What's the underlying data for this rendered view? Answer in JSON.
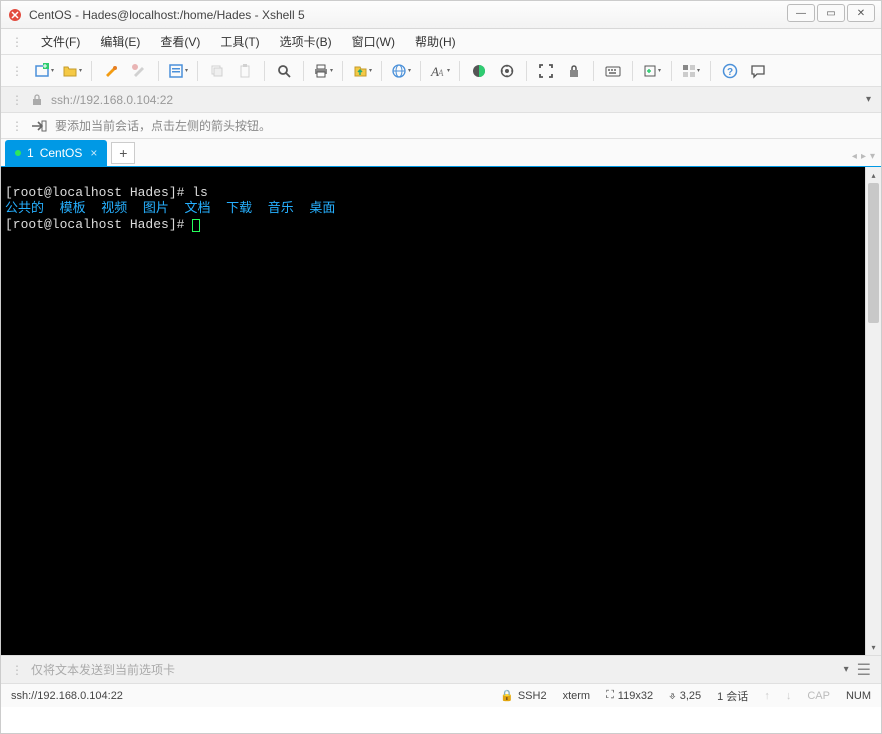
{
  "window": {
    "title": "CentOS - Hades@localhost:/home/Hades - Xshell 5"
  },
  "menu": {
    "file": "文件(F)",
    "edit": "编辑(E)",
    "view": "查看(V)",
    "tools": "工具(T)",
    "tab": "选项卡(B)",
    "window": "窗口(W)",
    "help": "帮助(H)"
  },
  "address": {
    "text": "ssh://192.168.0.104:22"
  },
  "hint": {
    "text": "要添加当前会话，点击左侧的箭头按钮。"
  },
  "tabs": {
    "active": {
      "index": "1",
      "label": "CentOS"
    },
    "add": "+"
  },
  "terminal": {
    "prompt1_pre": "[root@localhost Hades]# ",
    "cmd1": "ls",
    "ls_items": [
      "公共的",
      "模板",
      "视频",
      "图片",
      "文档",
      "下载",
      "音乐",
      "桌面"
    ],
    "prompt2_pre": "[root@localhost Hades]# "
  },
  "inputbar": {
    "placeholder": "仅将文本发送到当前选项卡"
  },
  "status": {
    "conn": "ssh://192.168.0.104:22",
    "proto": "SSH2",
    "term": "xterm",
    "size": "119x32",
    "pos": "3,25",
    "sess": "1 会话",
    "cap": "CAP",
    "num": "NUM"
  }
}
